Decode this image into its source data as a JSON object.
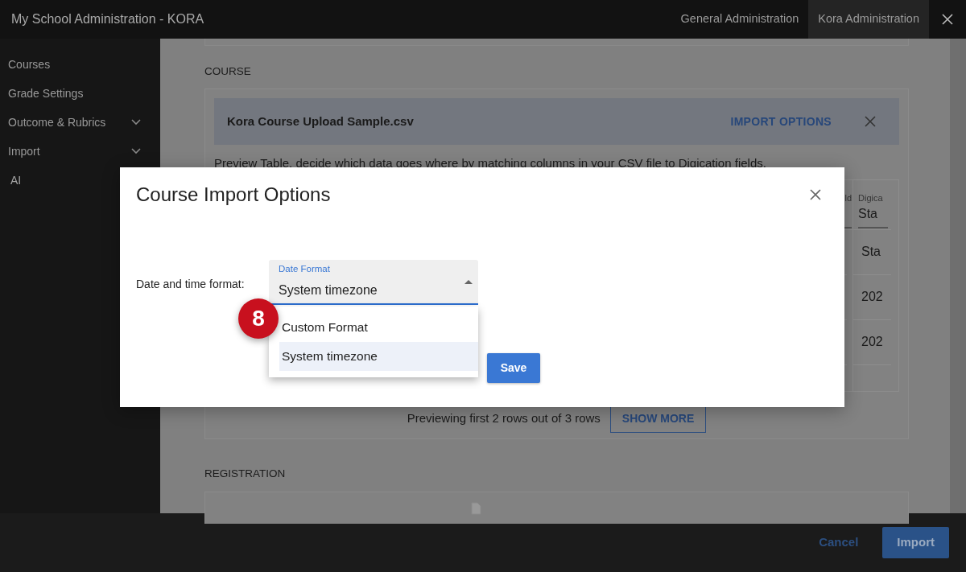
{
  "window": {
    "title": "My School Administration - KORA"
  },
  "top_tabs": [
    {
      "label": "General Administration",
      "selected": false
    },
    {
      "label": "Kora Administration",
      "selected": true
    }
  ],
  "sidebar": {
    "items": [
      {
        "label": "Courses"
      },
      {
        "label": "Grade Settings"
      },
      {
        "label": "Outcome & Rubrics",
        "expanded": false
      },
      {
        "label": "Import",
        "expanded": false
      },
      {
        "label": "AI"
      }
    ]
  },
  "course_section": {
    "heading": "COURSE",
    "file_name": "Kora Course Upload Sample.csv",
    "import_options": "IMPORT OPTIONS",
    "instructions": "Preview Table, decide which data goes where by matching columns in your CSV file to Digication fields.",
    "table": {
      "columns": [
        {
          "header_label": "ld"
        },
        {
          "header_label": "Digica",
          "header_value": "Sta",
          "cells": [
            "Sta",
            "202",
            "202"
          ]
        }
      ]
    },
    "preview_note": "Previewing first 2 rows out of 3 rows",
    "show_more": "SHOW MORE"
  },
  "registration_section": {
    "heading": "REGISTRATION"
  },
  "footer": {
    "cancel": "Cancel",
    "import": "Import"
  },
  "modal": {
    "title": "Course Import Options",
    "field_label": "Date and time format:",
    "select": {
      "label": "Date Format",
      "value": "System timezone",
      "expanded": true,
      "options": [
        {
          "label": "Custom Format",
          "selected": false
        },
        {
          "label": "System timezone",
          "selected": true
        }
      ]
    },
    "save": "Save"
  },
  "step_badge": "8"
}
